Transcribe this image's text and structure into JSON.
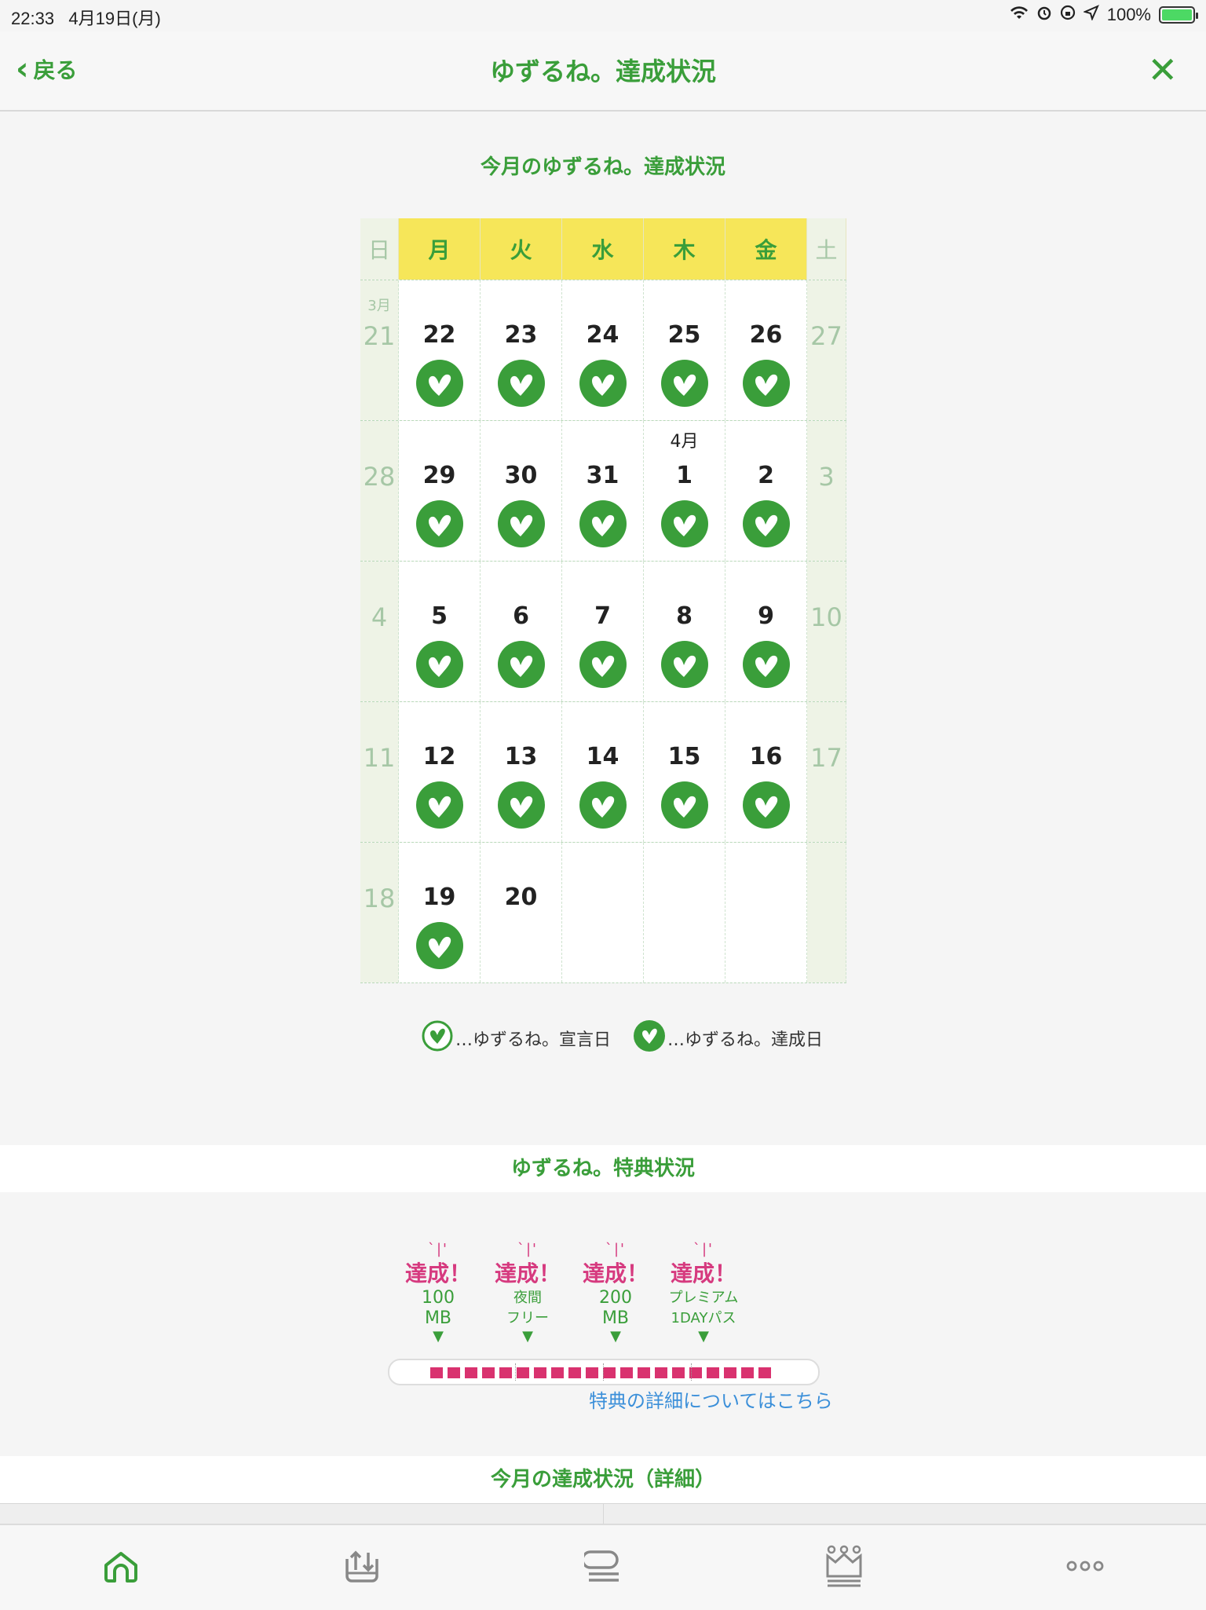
{
  "status_bar": {
    "time": "22:33",
    "date": "4月19日(月)",
    "battery": "100%"
  },
  "nav": {
    "back_label": "戻る",
    "title": "ゆずるね。達成状況",
    "close_icon": "close-icon"
  },
  "calendar": {
    "title": "今月のゆずるね。達成状況",
    "weekdays": [
      "日",
      "月",
      "火",
      "水",
      "木",
      "金",
      "土"
    ],
    "weeks": [
      [
        {
          "d": "21",
          "m": "3月"
        },
        {
          "d": "22",
          "a": true
        },
        {
          "d": "23",
          "a": true
        },
        {
          "d": "24",
          "a": true
        },
        {
          "d": "25",
          "a": true
        },
        {
          "d": "26",
          "a": true
        },
        {
          "d": "27"
        }
      ],
      [
        {
          "d": "28"
        },
        {
          "d": "29",
          "a": true
        },
        {
          "d": "30",
          "a": true
        },
        {
          "d": "31",
          "a": true
        },
        {
          "d": "1",
          "m": "4月",
          "a": true
        },
        {
          "d": "2",
          "a": true
        },
        {
          "d": "3"
        }
      ],
      [
        {
          "d": "4"
        },
        {
          "d": "5",
          "a": true
        },
        {
          "d": "6",
          "a": true
        },
        {
          "d": "7",
          "a": true
        },
        {
          "d": "8",
          "a": true
        },
        {
          "d": "9",
          "a": true
        },
        {
          "d": "10"
        }
      ],
      [
        {
          "d": "11"
        },
        {
          "d": "12",
          "a": true
        },
        {
          "d": "13",
          "a": true
        },
        {
          "d": "14",
          "a": true
        },
        {
          "d": "15",
          "a": true
        },
        {
          "d": "16",
          "a": true
        },
        {
          "d": "17"
        }
      ],
      [
        {
          "d": "18"
        },
        {
          "d": "19",
          "a": true
        },
        {
          "d": "20"
        },
        {
          "d": ""
        },
        {
          "d": ""
        },
        {
          "d": ""
        },
        {
          "d": ""
        }
      ]
    ]
  },
  "legend": {
    "declared": "…ゆずるね。宣言日",
    "achieved": "…ゆずるね。達成日"
  },
  "perks": {
    "title": "ゆずるね。特典状況",
    "items": [
      {
        "status": "達成！",
        "line1": "100",
        "line2": "MB"
      },
      {
        "status": "達成！",
        "line1": "夜間",
        "line2": "フリー"
      },
      {
        "status": "達成！",
        "line1": "200",
        "line2": "MB"
      },
      {
        "status": "達成！",
        "line1": "プレミアム",
        "line2": "1DAYパス"
      }
    ],
    "progress_filled_segments": 20,
    "link": "特典の詳細についてはこちら"
  },
  "detail": {
    "title": "今月の達成状況（詳細）"
  },
  "tabs": [
    {
      "icon": "home-icon",
      "active": true
    },
    {
      "icon": "data-transfer-icon"
    },
    {
      "icon": "chat-list-icon"
    },
    {
      "icon": "ranking-icon"
    },
    {
      "icon": "more-icon"
    }
  ],
  "colors": {
    "accent_green": "#3a9e3a",
    "weekday_header": "#f6e659",
    "achieved_pink": "#d63a7f",
    "link_blue": "#3b8fd9"
  }
}
